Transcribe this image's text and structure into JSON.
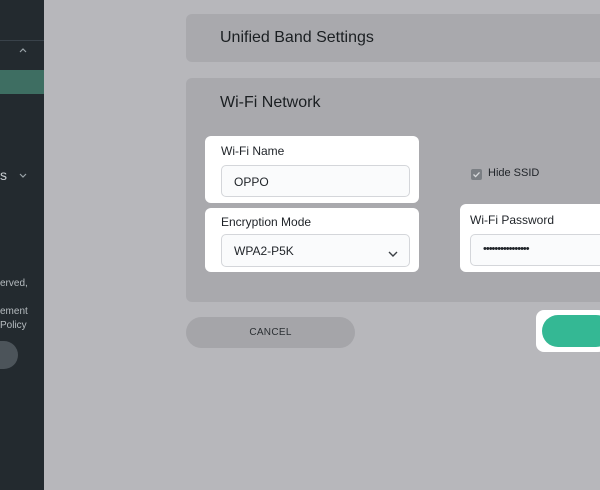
{
  "sidebar": {
    "partial_label": "s",
    "footer_lines": [
      "erved,",
      "ement",
      "Policy"
    ]
  },
  "unified_band": {
    "title": "Unified Band Settings"
  },
  "wifi_network": {
    "title": "Wi-Fi Network",
    "wifi_name": {
      "label": "Wi-Fi Name",
      "value": "OPPO"
    },
    "encryption_mode": {
      "label": "Encryption Mode",
      "value": "WPA2-P5K"
    },
    "hide_ssid": {
      "label": "Hide SSID",
      "checked": true
    },
    "wifi_password": {
      "label": "Wi-Fi Password",
      "value": "••••••••••••••••"
    }
  },
  "actions": {
    "cancel_label": "CANCEL",
    "save_label": ""
  },
  "colors": {
    "accent": "#34b894",
    "sidebar_bg": "#232a2f",
    "overlay": "#b7b7bb"
  }
}
